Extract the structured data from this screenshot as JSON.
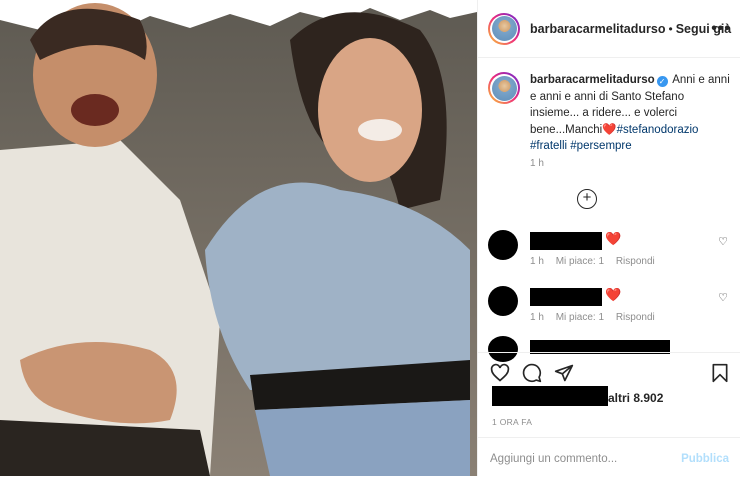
{
  "post": {
    "header": {
      "username": "barbaracarmelitadurso",
      "separator": "•",
      "follow_label": "Segui già",
      "more_label": "•••"
    },
    "caption": {
      "username": "barbaracarmelitadurso",
      "text": "Anni e anni e anni e anni di Santo Stefano insieme... a ridere... e volerci bene...Manchi",
      "emoji": "❤️",
      "hashtags": [
        "#stefanodorazio",
        "#fratelli",
        "#persempre"
      ],
      "time": "1 h"
    },
    "load_more_label": "+",
    "comments": [
      {
        "emoji": "❤️",
        "time": "1 h",
        "likes": "Mi piace: 1",
        "reply": "Rispondi"
      },
      {
        "emoji": "❤️",
        "time": "1 h",
        "likes": "Mi piace: 1",
        "reply": "Rispondi"
      }
    ],
    "likes_text": "altri 8.902",
    "date": "1 ORA FA",
    "add_comment_placeholder": "Aggiungi un commento...",
    "publish_label": "Pubblica",
    "icons": [
      "heart-icon",
      "comment-icon",
      "share-icon",
      "bookmark-icon"
    ]
  }
}
